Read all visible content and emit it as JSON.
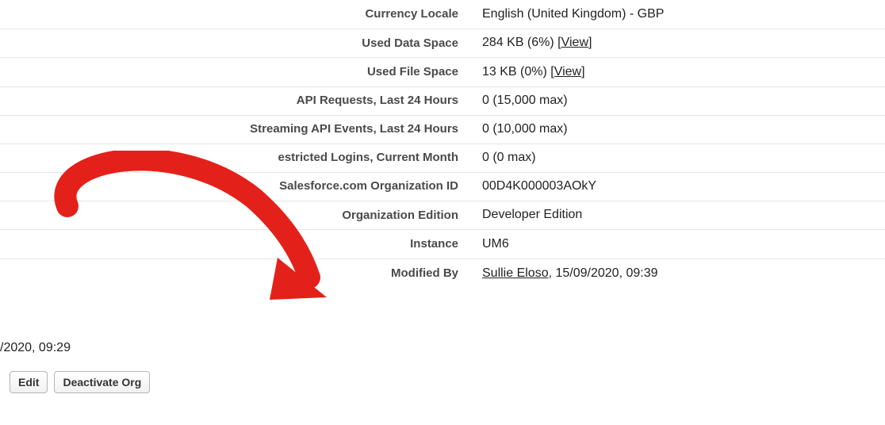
{
  "rows": {
    "currency_locale": {
      "label": "Currency Locale",
      "value": "English (United Kingdom) - GBP"
    },
    "used_data_space": {
      "label": "Used Data Space",
      "value_prefix": "284 KB (6%) [",
      "view": "View",
      "value_suffix": "]"
    },
    "used_file_space": {
      "label": "Used File Space",
      "value_prefix": "13 KB (0%) [",
      "view": "View",
      "value_suffix": "]"
    },
    "api_requests": {
      "label": "API Requests, Last 24 Hours",
      "value": "0 (15,000 max)"
    },
    "streaming_api": {
      "label": "Streaming API Events, Last 24 Hours",
      "value": "0 (10,000 max)"
    },
    "restricted_logins": {
      "label": "estricted Logins, Current Month",
      "value": "0 (0 max)"
    },
    "org_id": {
      "label": "Salesforce.com Organization ID",
      "value": "00D4K000003AOkY"
    },
    "org_edition": {
      "label": "Organization Edition",
      "value": "Developer Edition"
    },
    "instance": {
      "label": "Instance",
      "value": "UM6"
    },
    "modified_by": {
      "label": "Modified By",
      "user": "Sullie Eloso",
      "timestamp": ", 15/09/2020, 09:39"
    }
  },
  "left_timestamp": "/2020, 09:29",
  "buttons": {
    "edit": "Edit",
    "deactivate": "Deactivate Org"
  }
}
